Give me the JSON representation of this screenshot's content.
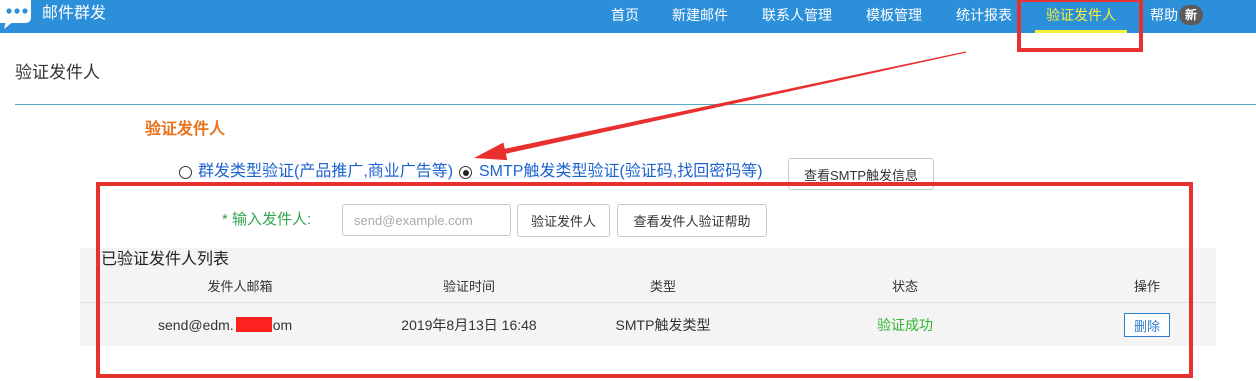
{
  "app": {
    "title": "邮件群发",
    "icon": "chat-bubble-icon"
  },
  "nav": {
    "items": [
      {
        "label": "首页",
        "active": false
      },
      {
        "label": "新建邮件",
        "active": false
      },
      {
        "label": "联系人管理",
        "active": false
      },
      {
        "label": "模板管理",
        "active": false
      },
      {
        "label": "统计报表",
        "active": false
      },
      {
        "label": "验证发件人",
        "active": true
      },
      {
        "label": "帮助",
        "active": false,
        "badge": "新"
      }
    ]
  },
  "page": {
    "title": "验证发件人"
  },
  "section": {
    "title": "验证发件人",
    "radios": [
      {
        "label": "群发类型验证(产品推广,商业广告等)",
        "checked": false
      },
      {
        "label": "SMTP触发类型验证(验证码,找回密码等)",
        "checked": true
      }
    ],
    "smtp_info_button": "查看SMTP触发信息",
    "sender_label": "* 输入发件人:",
    "sender_input": {
      "value": "",
      "placeholder": "send@example.com"
    },
    "verify_button": "验证发件人",
    "help_button": "查看发件人验证帮助"
  },
  "table": {
    "title": "已验证发件人列表",
    "columns": [
      "发件人邮箱",
      "验证时间",
      "类型",
      "状态",
      "操作"
    ],
    "rows": [
      {
        "email_visible_start": "send@edm.",
        "email_visible_end": "om",
        "time": "2019年8月13日 16:48",
        "type": "SMTP触发类型",
        "status": "验证成功",
        "action": "删除"
      }
    ]
  },
  "colors": {
    "nav_bg": "#2c8fd9",
    "nav_text": "#ffffff",
    "nav_active": "#f7f03a",
    "badge_bg": "#5c5c5c",
    "divider": "#57a9c8",
    "section_title": "#e8731d",
    "radio_label": "#1d63d0",
    "required_label": "#33a652",
    "status_success": "#2fb52f",
    "link_button": "#2d7fd0",
    "table_bg": "#f4f4f4",
    "annotation": "#e8302f",
    "redaction": "#ff2020"
  }
}
